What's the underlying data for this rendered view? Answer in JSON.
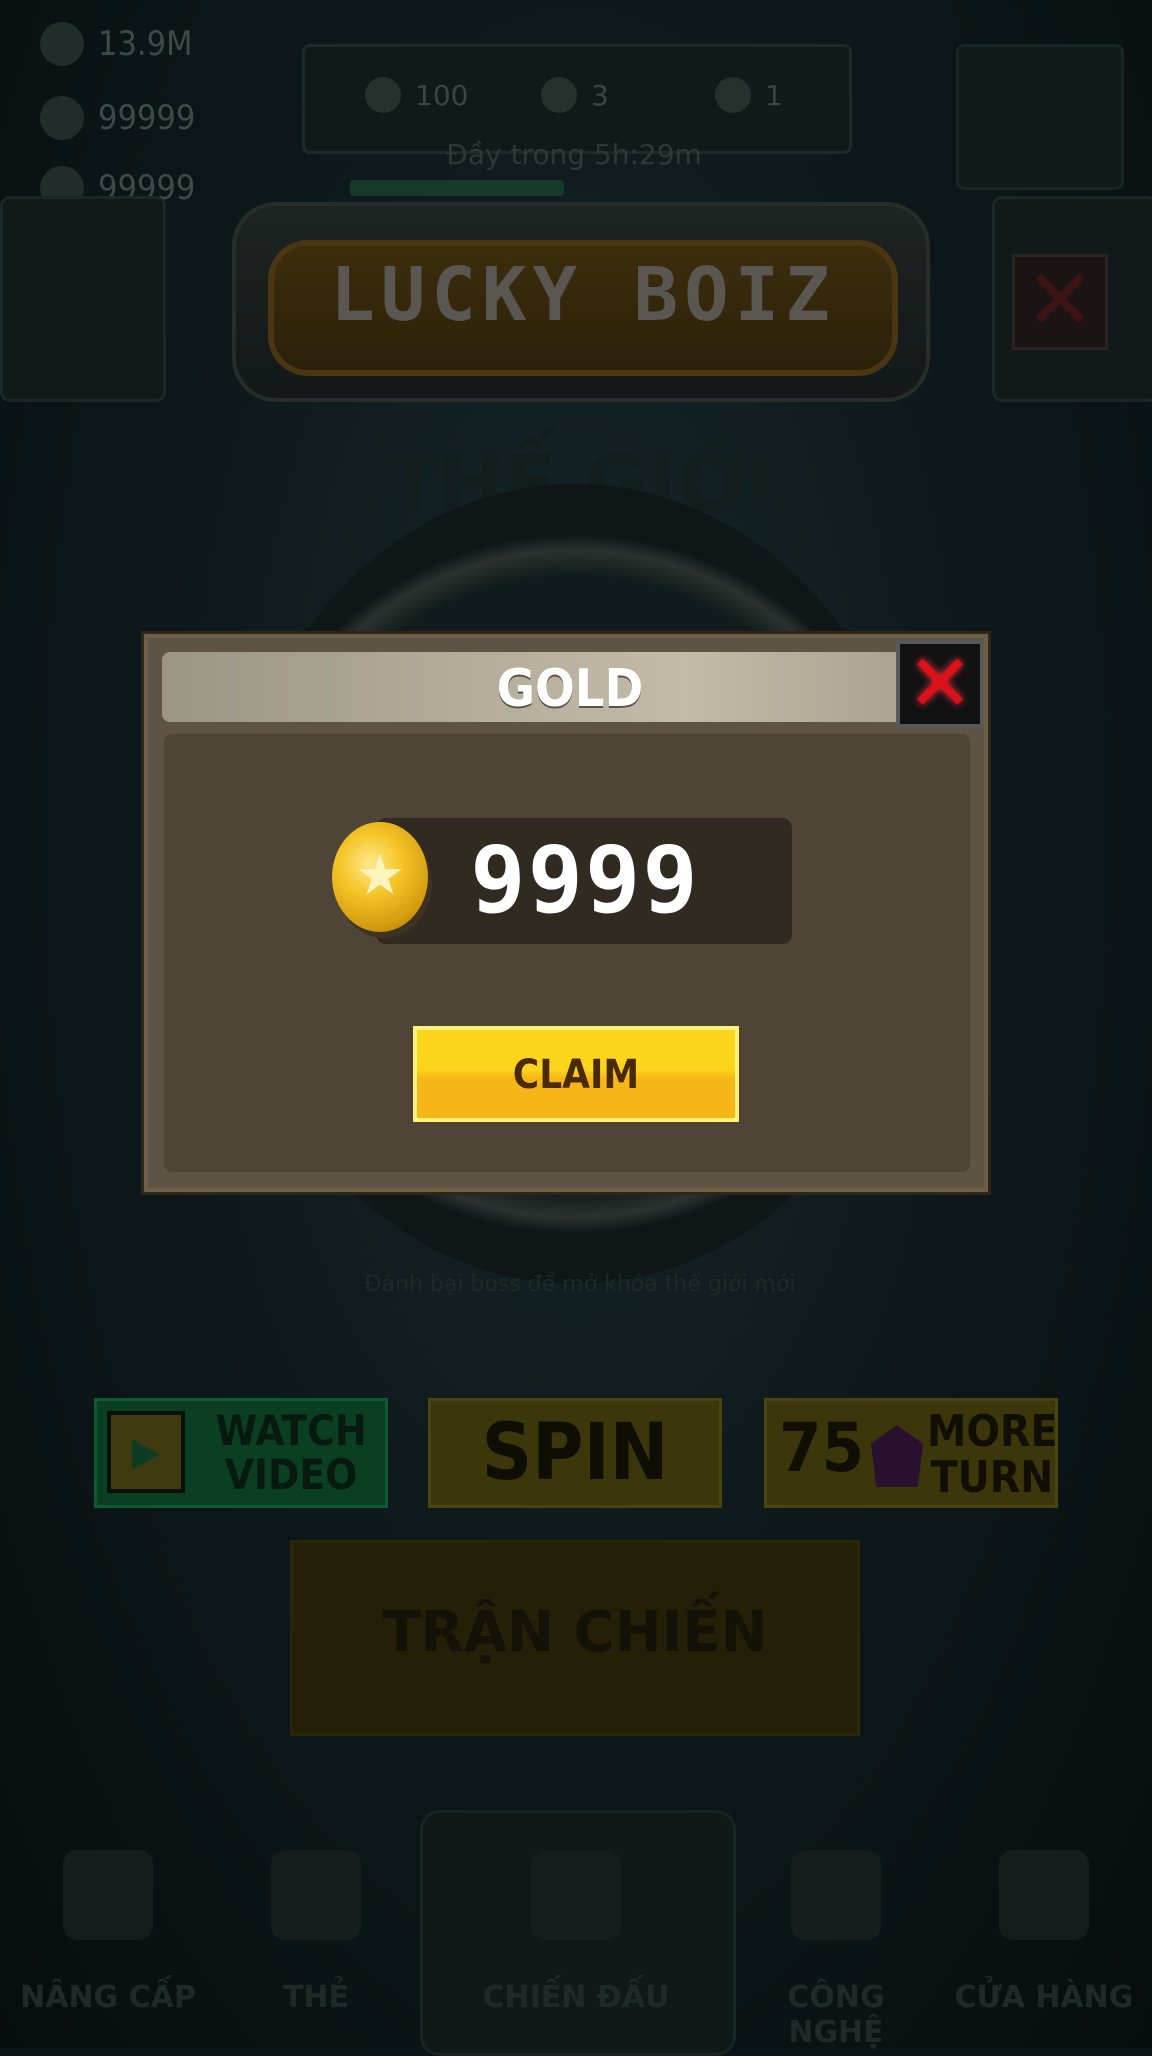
{
  "resources": {
    "cash": "13.9M",
    "gold": "99999",
    "gems": "99999"
  },
  "energy": {
    "item1": "100",
    "item2": "3",
    "item3": "1",
    "timer": "Đầy trong 5h:29m"
  },
  "marquee": {
    "title": "LUCKY BOIZ"
  },
  "world_title": "THẾ GIỚI 1",
  "wheel_hint": "Đánh bại boss để mở khóa thế giới mới",
  "actions": {
    "watch_video": "WATCH VIDEO",
    "spin": "SPIN",
    "more_turn_count": "75",
    "more_turn": "MORE TURN"
  },
  "battle_button": "TRẬN CHIẾN",
  "nav": [
    "NÂNG CẤP",
    "THẺ",
    "CHIẾN ĐẤU",
    "CÔNG NGHỆ",
    "CỬA HÀNG"
  ],
  "dialog": {
    "title": "GOLD",
    "amount": "9999",
    "claim_label": "CLAIM",
    "close_glyph": "✕",
    "coin_glyph": "★"
  },
  "colors": {
    "claim": "#fbd41c",
    "dialog_bg": "#4f4536",
    "close_x": "#e0101a"
  },
  "icons": [
    "cash-icon",
    "gold-coin-icon",
    "gem-icon",
    "play-icon",
    "purple-gem-icon",
    "close-icon",
    "wrench-icon",
    "lock-icon",
    "cart-icon"
  ]
}
